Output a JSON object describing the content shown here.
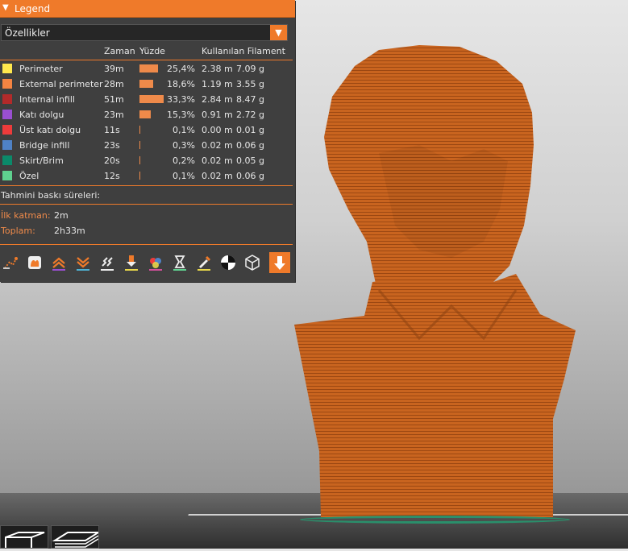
{
  "legend": {
    "title": "Legend",
    "view_type": "Özellikler",
    "columns": {
      "time": "Zaman",
      "percent": "Yüzde",
      "used_filament": "Kullanılan Filament"
    },
    "features": [
      {
        "name": "Perimeter",
        "color": "#ffe84d",
        "time": "39m",
        "percent_value": 25.4,
        "percent": "25,4%",
        "length": "2.38 m",
        "weight": "7.09 g"
      },
      {
        "name": "External perimeter",
        "color": "#f58442",
        "time": "28m",
        "percent_value": 18.6,
        "percent": "18,6%",
        "length": "1.19 m",
        "weight": "3.55 g"
      },
      {
        "name": "Internal infill",
        "color": "#b32a2a",
        "time": "51m",
        "percent_value": 33.3,
        "percent": "33,3%",
        "length": "2.84 m",
        "weight": "8.47 g"
      },
      {
        "name": "Katı dolgu",
        "color": "#9a4fd1",
        "time": "23m",
        "percent_value": 15.3,
        "percent": "15,3%",
        "length": "0.91 m",
        "weight": "2.72 g"
      },
      {
        "name": "Üst katı dolgu",
        "color": "#ee3b3b",
        "time": "11s",
        "percent_value": 0.1,
        "percent": "0,1%",
        "length": "0.00 m",
        "weight": "0.01 g"
      },
      {
        "name": "Bridge infill",
        "color": "#4f82c6",
        "time": "23s",
        "percent_value": 0.3,
        "percent": "0,3%",
        "length": "0.02 m",
        "weight": "0.06 g"
      },
      {
        "name": "Skirt/Brim",
        "color": "#0b8a6a",
        "time": "20s",
        "percent_value": 0.2,
        "percent": "0,2%",
        "length": "0.02 m",
        "weight": "0.05 g"
      },
      {
        "name": "Özel",
        "color": "#5fd18f",
        "time": "12s",
        "percent_value": 0.1,
        "percent": "0,1%",
        "length": "0.02 m",
        "weight": "0.06 g"
      }
    ],
    "estimates": {
      "title": "Tahmini baskı süreleri:",
      "first_layer_label": "İlk katman:",
      "first_layer_value": "2m",
      "total_label": "Toplam:",
      "total_value": "2h33m"
    },
    "toolbar_icons": [
      "travel-icon",
      "wipe-icon",
      "retractions-icon",
      "deretractions-icon",
      "seams-icon",
      "tool-changes-icon",
      "color-changes-icon",
      "pause-prints-icon",
      "custom-gcodes-icon",
      "center-of-gravity-icon",
      "shells-icon",
      "tool-marker-icon"
    ]
  },
  "model": {
    "color": "#c8621f"
  }
}
